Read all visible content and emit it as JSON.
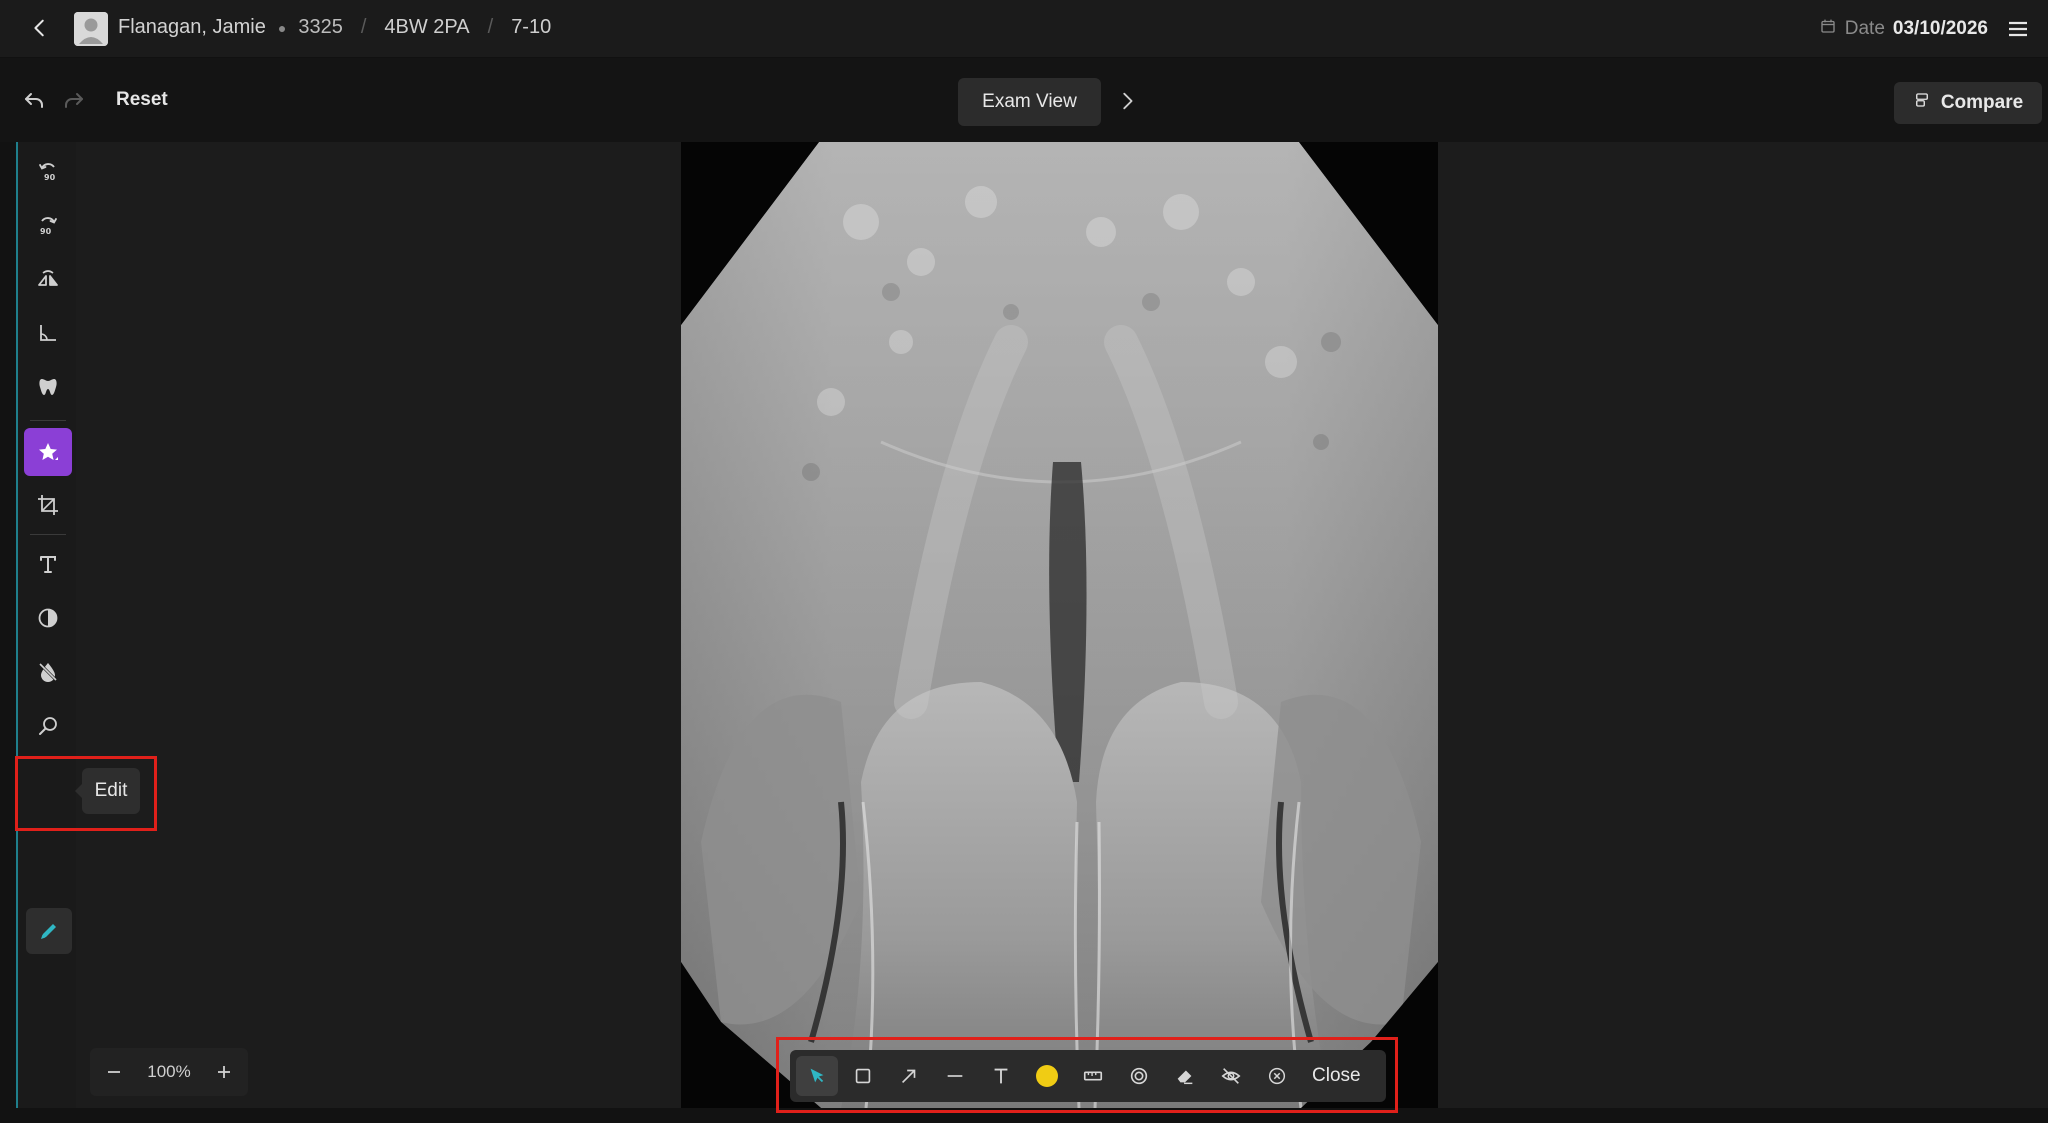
{
  "header": {
    "patient_name": "Flanagan, Jamie",
    "patient_id": "3325",
    "exam": "4BW 2PA",
    "series": "7-10",
    "date_label": "Date",
    "date_value": "03/10/2026"
  },
  "toolbar": {
    "reset_label": "Reset",
    "exam_view_label": "Exam View",
    "compare_label": "Compare"
  },
  "sidebar": {
    "tools": [
      {
        "name": "rotate-left-90",
        "icon": "rotate-left-icon",
        "label": "90"
      },
      {
        "name": "rotate-right-90",
        "icon": "rotate-right-icon",
        "label": "90"
      },
      {
        "name": "flip",
        "icon": "flip-icon"
      },
      {
        "name": "angle",
        "icon": "angle-icon"
      },
      {
        "name": "tooth",
        "icon": "tooth-icon"
      },
      {
        "name": "favorite",
        "icon": "star-icon",
        "active": true
      },
      {
        "name": "crop",
        "icon": "crop-icon"
      },
      {
        "name": "text",
        "icon": "text-icon"
      },
      {
        "name": "contrast",
        "icon": "contrast-icon"
      },
      {
        "name": "invert",
        "icon": "invert-icon"
      },
      {
        "name": "magnify",
        "icon": "magnify-icon"
      },
      {
        "name": "edit",
        "icon": "pencil-icon"
      }
    ],
    "edit_tooltip": "Edit"
  },
  "zoom": {
    "value": "100%"
  },
  "annotation_toolbar": {
    "tools": [
      "select",
      "rectangle",
      "arrow",
      "line",
      "text",
      "color",
      "ruler",
      "circle",
      "eraser",
      "hide",
      "clear"
    ],
    "color": "#f0cc14",
    "close_label": "Close"
  },
  "colors": {
    "accent_teal": "#1f7f8c",
    "active_purple": "#8b3fd6",
    "highlight_red": "#e0201a"
  }
}
